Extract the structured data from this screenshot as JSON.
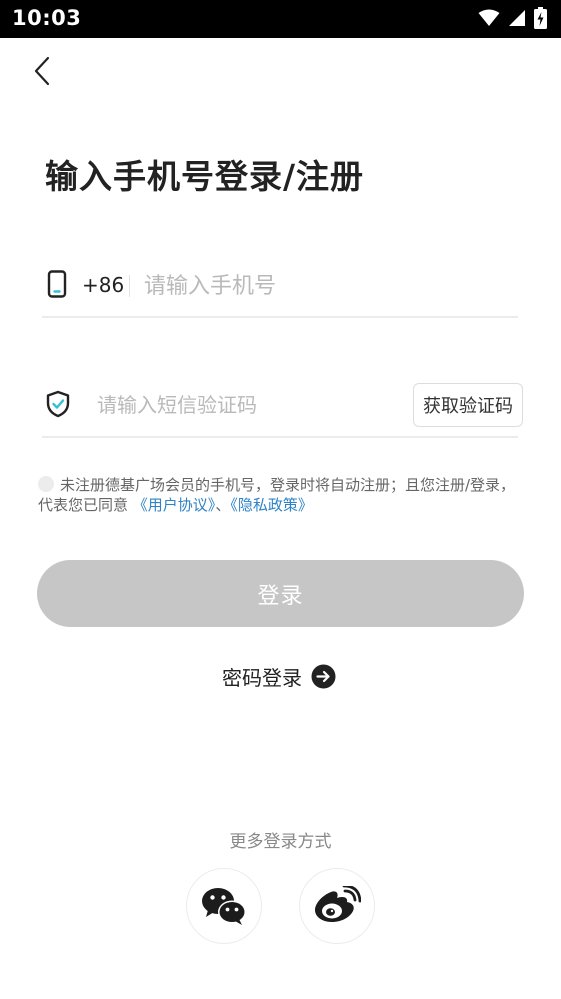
{
  "status_bar": {
    "time": "10:03"
  },
  "title": "输入手机号登录/注册",
  "phone": {
    "country_code": "+86",
    "placeholder": "请输入手机号",
    "value": ""
  },
  "sms_code": {
    "placeholder": "请输入短信验证码",
    "value": "",
    "get_code_label": "获取验证码"
  },
  "agreement": {
    "checked": false,
    "text": "未注册德基广场会员的手机号，登录时将自动注册；且您注册/登录，代表您已同意",
    "user_agreement_link": "《用户协议》",
    "separator": "、",
    "privacy_policy_link": "《隐私政策》"
  },
  "login_button": {
    "label": "登录",
    "enabled": false
  },
  "password_login": {
    "label": "密码登录"
  },
  "more_login": {
    "label": "更多登录方式"
  },
  "social_logins": [
    {
      "icon": "wechat-icon"
    },
    {
      "icon": "weibo-icon"
    }
  ],
  "colors": {
    "link": "#2f82c6",
    "login_button_disabled": "#c6c6c6",
    "shield_check_accent": "#30c2d4",
    "phone_icon_accent": "#30c2d4"
  }
}
